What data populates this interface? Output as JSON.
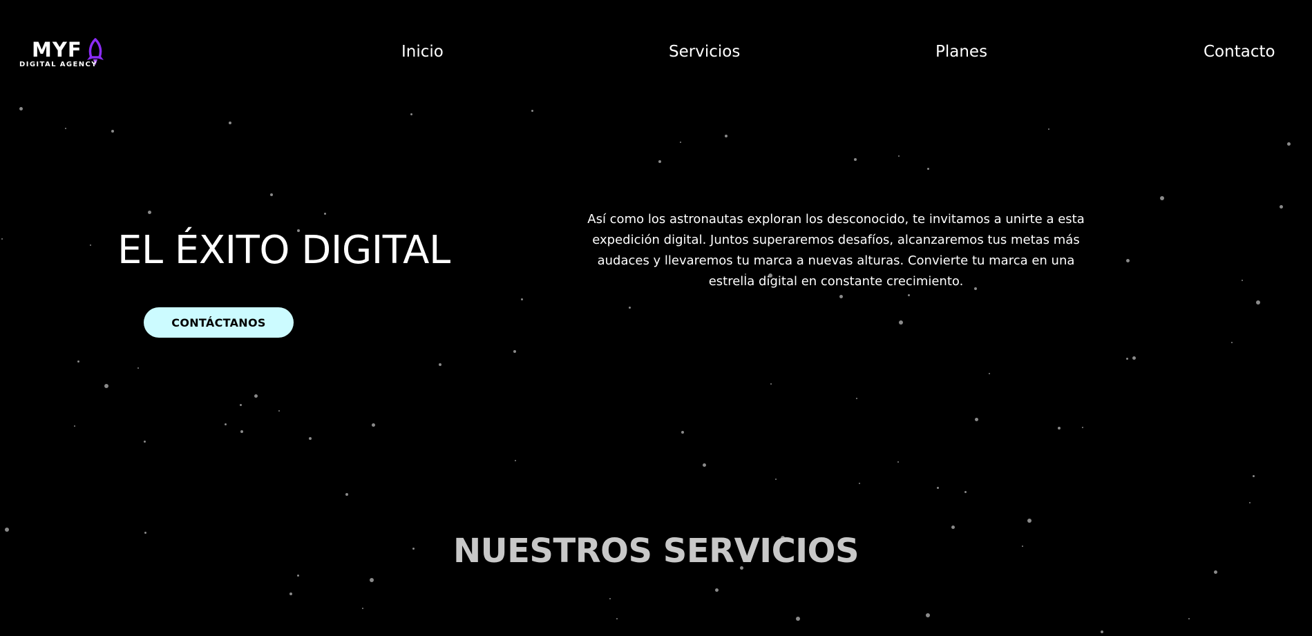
{
  "brand": {
    "name": "MYF",
    "tagline": "DIGITAL AGENCY",
    "icon": "rocket-icon",
    "icon_color": "#8b2cf5"
  },
  "nav": {
    "items": [
      {
        "label": "Inicio"
      },
      {
        "label": "Servicios"
      },
      {
        "label": "Planes"
      },
      {
        "label": "Contacto"
      }
    ]
  },
  "hero": {
    "title": "EL ÉXITO DIGITAL",
    "cta_label": "CONTÁCTANOS",
    "cta_color": "#ccfbff",
    "description": "Así como los astronautas exploran los desconocido, te invitamos a unirte a esta expedición digital. Juntos superaremos desafíos, alcanzaremos tus metas más audaces y llevaremos tu marca a nuevas alturas. Convierte tu marca en una estrella digital en constante crecimiento."
  },
  "services": {
    "title": "NUESTROS SERVICIOS"
  },
  "theme": {
    "background": "#000000",
    "star_color": "#8a8a8a",
    "text_color": "#ffffff"
  }
}
